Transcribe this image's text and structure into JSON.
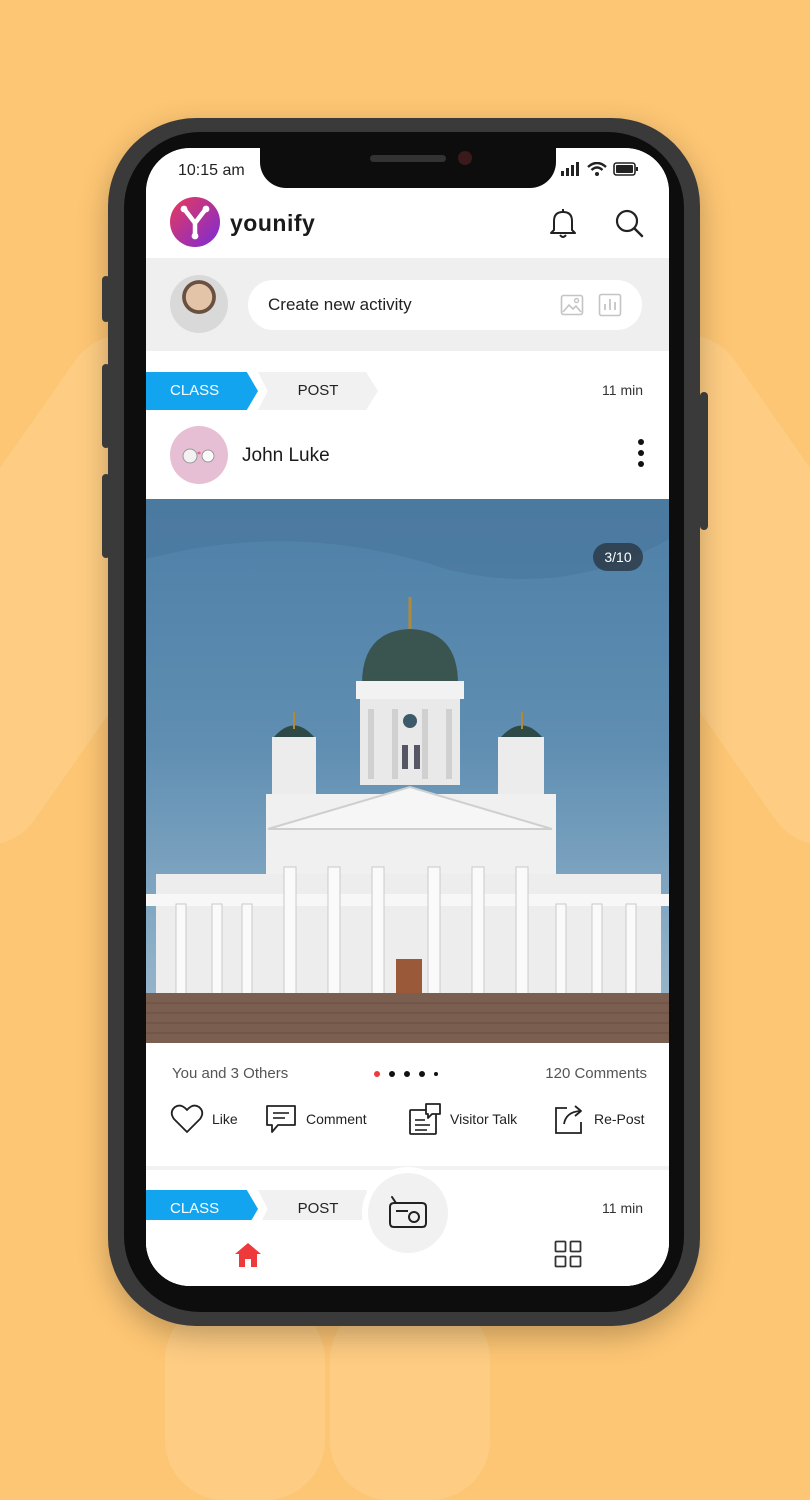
{
  "status": {
    "time": "10:15 am"
  },
  "app": {
    "brand": "younify"
  },
  "composer": {
    "placeholder": "Create new activity"
  },
  "post": {
    "tag_class": "CLASS",
    "tag_post": "POST",
    "time": "11 min",
    "author": "John Luke",
    "counter": "3/10",
    "likes_text": "You and 3 Others",
    "comments_text": "120 Comments",
    "actions": {
      "like": "Like",
      "comment": "Comment",
      "visitor": "Visitor Talk",
      "repost": "Re-Post"
    }
  },
  "post2": {
    "tag_class": "CLASS",
    "tag_post": "POST",
    "time": "11 min"
  },
  "colors": {
    "accent": "#12a4ef",
    "active": "#ee3a3a",
    "background": "#fdc674"
  },
  "icons": [
    "bell-icon",
    "search-icon",
    "image-icon",
    "poll-icon",
    "more-icon",
    "heart-icon",
    "comment-icon",
    "visitor-talk-icon",
    "repost-icon",
    "radio-icon",
    "home-icon",
    "grid-icon"
  ]
}
